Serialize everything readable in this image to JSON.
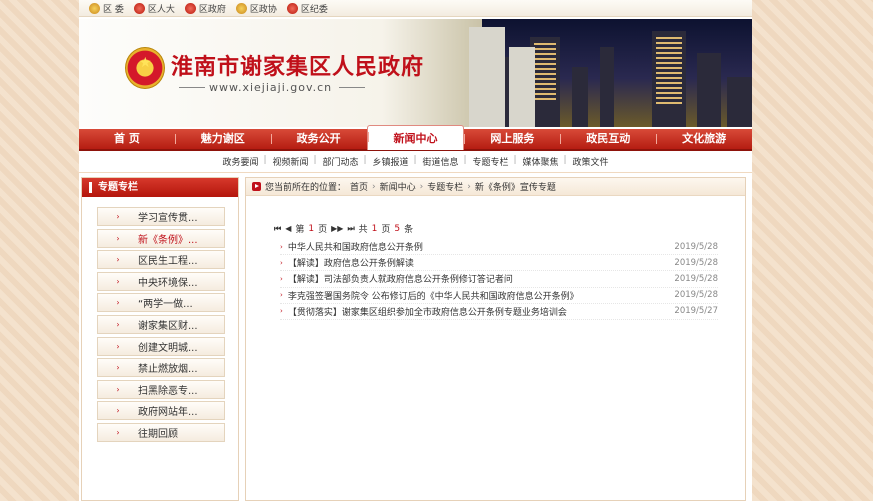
{
  "topbar": {
    "items": [
      {
        "label": "区 委",
        "icon": "party-emblem-icon",
        "color": "gold"
      },
      {
        "label": "区人大",
        "icon": "national-emblem-icon",
        "color": "red"
      },
      {
        "label": "区政府",
        "icon": "national-emblem-icon",
        "color": "red"
      },
      {
        "label": "区政协",
        "icon": "cppcc-emblem-icon",
        "color": "gold"
      },
      {
        "label": "区纪委",
        "icon": "party-emblem-icon",
        "color": "red"
      }
    ]
  },
  "header": {
    "title": "淮南市谢家集区人民政府",
    "url": "www.xiejiaji.gov.cn"
  },
  "nav": {
    "items": [
      "首 页",
      "魅力谢区",
      "政务公开",
      "新闻中心",
      "网上服务",
      "政民互动",
      "文化旅游"
    ],
    "active": "新闻中心"
  },
  "subnav": {
    "items": [
      "政务要闻",
      "视频新闻",
      "部门动态",
      "乡镇报道",
      "街道信息",
      "专题专栏",
      "媒体聚焦",
      "政策文件"
    ]
  },
  "sidebar": {
    "title": "专题专栏",
    "items": [
      {
        "label": "学习宣传贯...",
        "active": false
      },
      {
        "label": "新《条例》...",
        "active": true
      },
      {
        "label": "区民生工程...",
        "active": false
      },
      {
        "label": "中央环境保...",
        "active": false
      },
      {
        "label": "“两学一做...",
        "active": false
      },
      {
        "label": "谢家集区财...",
        "active": false
      },
      {
        "label": "创建文明城...",
        "active": false
      },
      {
        "label": "禁止燃放烟...",
        "active": false
      },
      {
        "label": "扫黑除恶专...",
        "active": false
      },
      {
        "label": "政府网站年...",
        "active": false
      },
      {
        "label": "往期回顾",
        "active": false
      }
    ]
  },
  "breadcrumb": {
    "prefix": "您当前所在的位置：",
    "items": [
      "首页",
      "新闻中心",
      "专题专栏",
      "新《条例》宣传专题"
    ]
  },
  "pager": {
    "first": "⏮",
    "prev": "◀",
    "next": "▶▶",
    "last": "⏭",
    "page_prefix": "第",
    "current": "1",
    "page_suffix": "页",
    "total_prefix": "共",
    "total_pages": "1",
    "total_mid": "页",
    "total_count": "5",
    "total_suffix": "条"
  },
  "news": [
    {
      "title": "中华人民共和国政府信息公开条例",
      "date": "2019/5/28"
    },
    {
      "title": "【解读】政府信息公开条例解读",
      "date": "2019/5/28"
    },
    {
      "title": "【解读】司法部负责人就政府信息公开条例修订答记者问",
      "date": "2019/5/28"
    },
    {
      "title": "李克强签署国务院令 公布修订后的《中华人民共和国政府信息公开条例》",
      "date": "2019/5/28"
    },
    {
      "title": "【贯彻落实】谢家集区组织参加全市政府信息公开条例专题业务培训会",
      "date": "2019/5/27"
    }
  ],
  "colors": {
    "accent": "#c0101a",
    "nav_bg": "#c22a1d",
    "background": "#f1dcc4"
  }
}
